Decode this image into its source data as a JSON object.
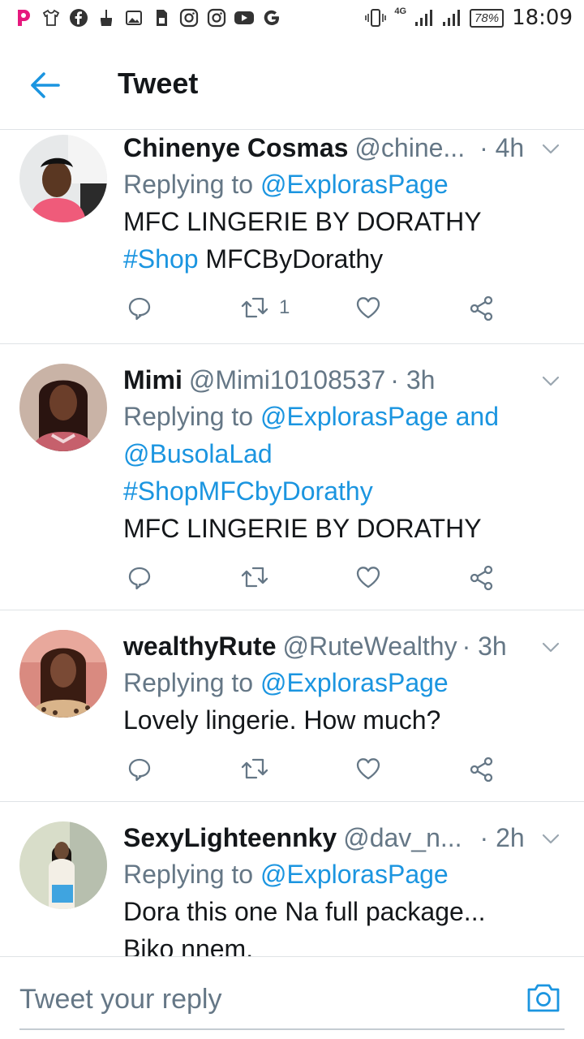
{
  "status_bar": {
    "network": "4G",
    "battery": "78%",
    "time": "18:09",
    "left_icons": [
      "p-app-icon",
      "tshirt-icon",
      "facebook-icon",
      "broom-icon",
      "image-icon",
      "sim-icon",
      "instagram-icon",
      "instagram-icon",
      "youtube-icon",
      "google-icon"
    ],
    "right_icons": [
      "vibrate-icon",
      "signal-icon",
      "signal-icon",
      "battery-icon"
    ]
  },
  "header": {
    "title": "Tweet",
    "back_icon": "arrow-left-icon"
  },
  "colors": {
    "accent": "#1b95e0",
    "text": "#14171a",
    "muted": "#657786",
    "divider": "#dfe3e6"
  },
  "tweets": [
    {
      "name": "Chinenye Cosmas",
      "handle": "@chine...",
      "time": "· 4h",
      "replying_prefix": "Replying to ",
      "replying_to": "@ExplorasPage",
      "replying_to_2": "",
      "body_line_1": "MFC LINGERIE BY DORATHY",
      "hashtag": "#Shop",
      "body_line_2_rest": " MFCByDorathy",
      "retweet_count": "1"
    },
    {
      "name": "Mimi",
      "handle": "@Mimi10108537",
      "time": "· 3h",
      "replying_prefix": "Replying to ",
      "replying_to": "@ExplorasPage",
      "replying_to_and": " and",
      "replying_to_2": "@BusolaLad",
      "hashtag": "#ShopMFCbyDorathy",
      "body_line_1": "MFC LINGERIE BY DORATHY",
      "retweet_count": ""
    },
    {
      "name": "wealthyRute",
      "handle": "@RuteWealthy",
      "time": "· 3h",
      "replying_prefix": "Replying to ",
      "replying_to": "@ExplorasPage",
      "body_line_1": "Lovely lingerie. How much?",
      "retweet_count": ""
    },
    {
      "name": "SexyLighteennky",
      "handle": "@dav_n...",
      "time": "· 2h",
      "replying_prefix": "Replying to ",
      "replying_to": "@ExplorasPage",
      "body_line_1": "Dora this one Na full package...",
      "body_line_2": "Biko nnem."
    }
  ],
  "action_icons": [
    "reply-icon",
    "retweet-icon",
    "like-icon",
    "share-icon"
  ],
  "reply_bar": {
    "placeholder": "Tweet your reply",
    "camera_icon": "camera-icon"
  }
}
